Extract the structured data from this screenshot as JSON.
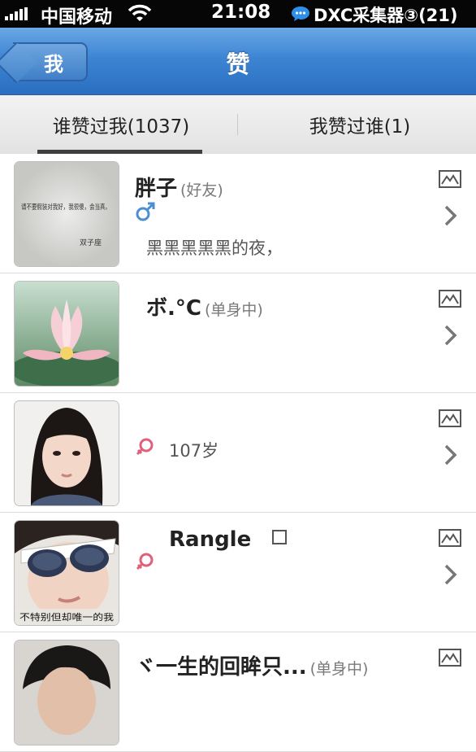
{
  "status_bar": {
    "carrier": "中国移动",
    "time": "21:08",
    "right_text": "DXC采集器③(21)"
  },
  "nav": {
    "back_label": "我",
    "title": "赞"
  },
  "tabs": [
    {
      "label": "谁赞过我(1037)",
      "active": true
    },
    {
      "label": "我赞过谁(1)",
      "active": false
    }
  ],
  "rows": [
    {
      "name": "胖子",
      "tag": "(好友)",
      "gender": "male",
      "detail": "黑黑黑黑黑的夜，",
      "avatar_text": "请不要假装对我好，我很傻，会当真。",
      "avatar_text_2": "双子座"
    },
    {
      "name": "ボ.°C",
      "tag": "(单身中)",
      "gender": "",
      "detail": ""
    },
    {
      "name": "",
      "tag": "",
      "gender": "female",
      "detail": "107岁"
    },
    {
      "name": "Rangle",
      "tag": "",
      "gender": "female",
      "detail": "",
      "avatar_text": "不特别但却唯一的我"
    },
    {
      "name": "ヾ一生的回眸只...",
      "tag": "(单身中)",
      "gender": "",
      "detail": ""
    }
  ],
  "colors": {
    "nav_blue": "#3d85d3",
    "male": "#4a8fd3",
    "female": "#e0607a"
  }
}
